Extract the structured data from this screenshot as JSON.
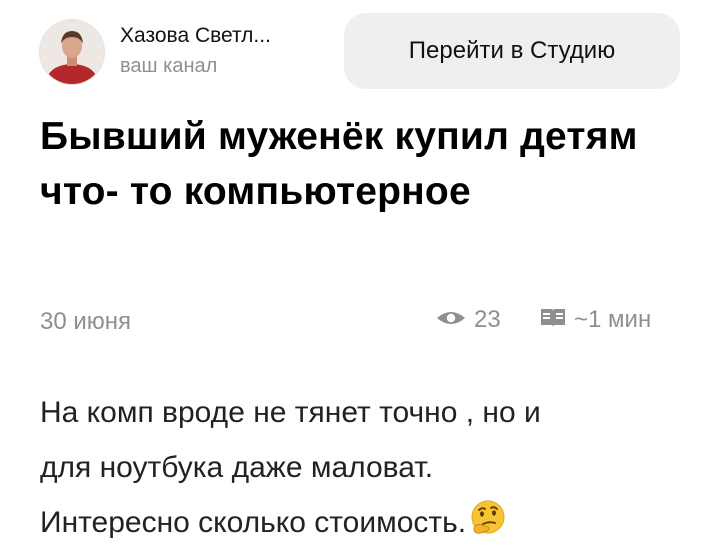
{
  "header": {
    "channel_name": "Хазова Светл...",
    "channel_subtitle": "ваш канал",
    "studio_button_label": "Перейти в Студию"
  },
  "article": {
    "title": "Бывший муженёк купил детям что- то компьютерное",
    "date": "30 июня",
    "views": "23",
    "read_time": "~1 мин",
    "body_lines": [
      "На комп вроде не тянет точно , но и",
      "для ноутбука даже маловат.",
      "Интересно сколько стоимость."
    ],
    "body_emoji": "thinking-face-icon"
  },
  "icons": {
    "avatar": "avatar",
    "views": "eye-icon",
    "read_time": "book-icon"
  },
  "colors": {
    "muted_text": "#8e8e93",
    "button_bg": "#efeff1",
    "title": "#000000",
    "body": "#222222"
  }
}
